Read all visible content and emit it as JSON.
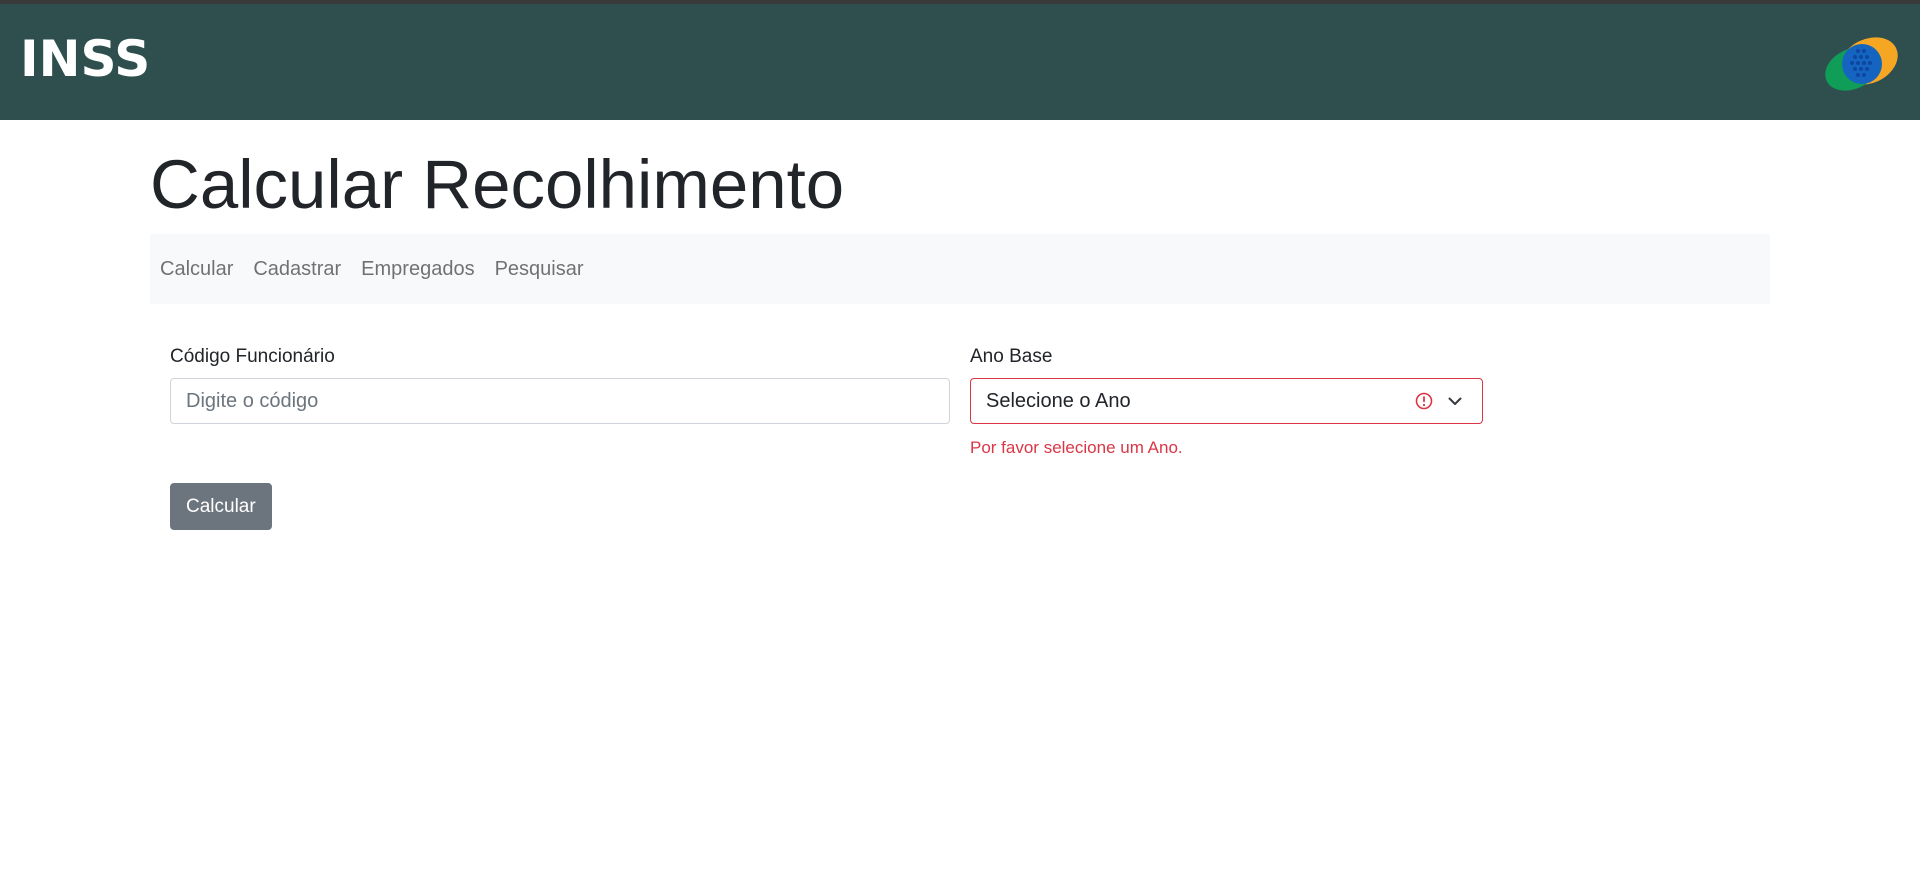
{
  "header": {
    "brand": "INSS",
    "logo_icon": "inss-logo-icon"
  },
  "page": {
    "title": "Calcular Recolhimento"
  },
  "nav": {
    "items": [
      {
        "label": "Calcular"
      },
      {
        "label": "Cadastrar"
      },
      {
        "label": "Empregados"
      },
      {
        "label": "Pesquisar"
      }
    ]
  },
  "form": {
    "employee_code": {
      "label": "Código Funcionário",
      "placeholder": "Digite o código",
      "value": ""
    },
    "base_year": {
      "label": "Ano Base",
      "selected": "Selecione o Ano",
      "error": "Por favor selecione um Ano."
    },
    "submit_label": "Calcular"
  },
  "colors": {
    "header_bg": "#2f4f4f",
    "nav_bg": "#f8f9fa",
    "error": "#dc3545",
    "button_bg": "#6c757d"
  }
}
